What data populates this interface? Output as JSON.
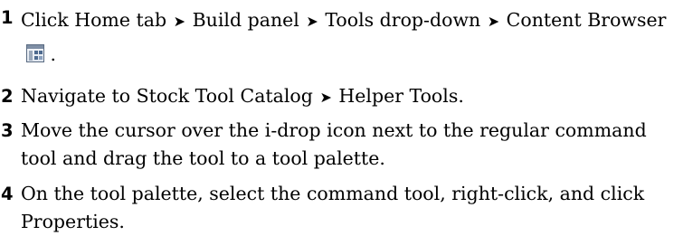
{
  "arrow_glyph": "➤",
  "steps": [
    {
      "number": "1",
      "parts": [
        "Click Home tab",
        "Build panel",
        "Tools drop-down",
        "Content Browser"
      ],
      "icon": "content-browser-icon",
      "end": "."
    },
    {
      "number": "2",
      "parts": [
        "Navigate to Stock Tool Catalog",
        "Helper Tools."
      ]
    },
    {
      "number": "3",
      "text": "Move the cursor over the i-drop icon next to the regular command tool and drag the tool to a tool palette."
    },
    {
      "number": "4",
      "text": "On the tool palette, select the command tool, right-click, and click Properties."
    }
  ]
}
